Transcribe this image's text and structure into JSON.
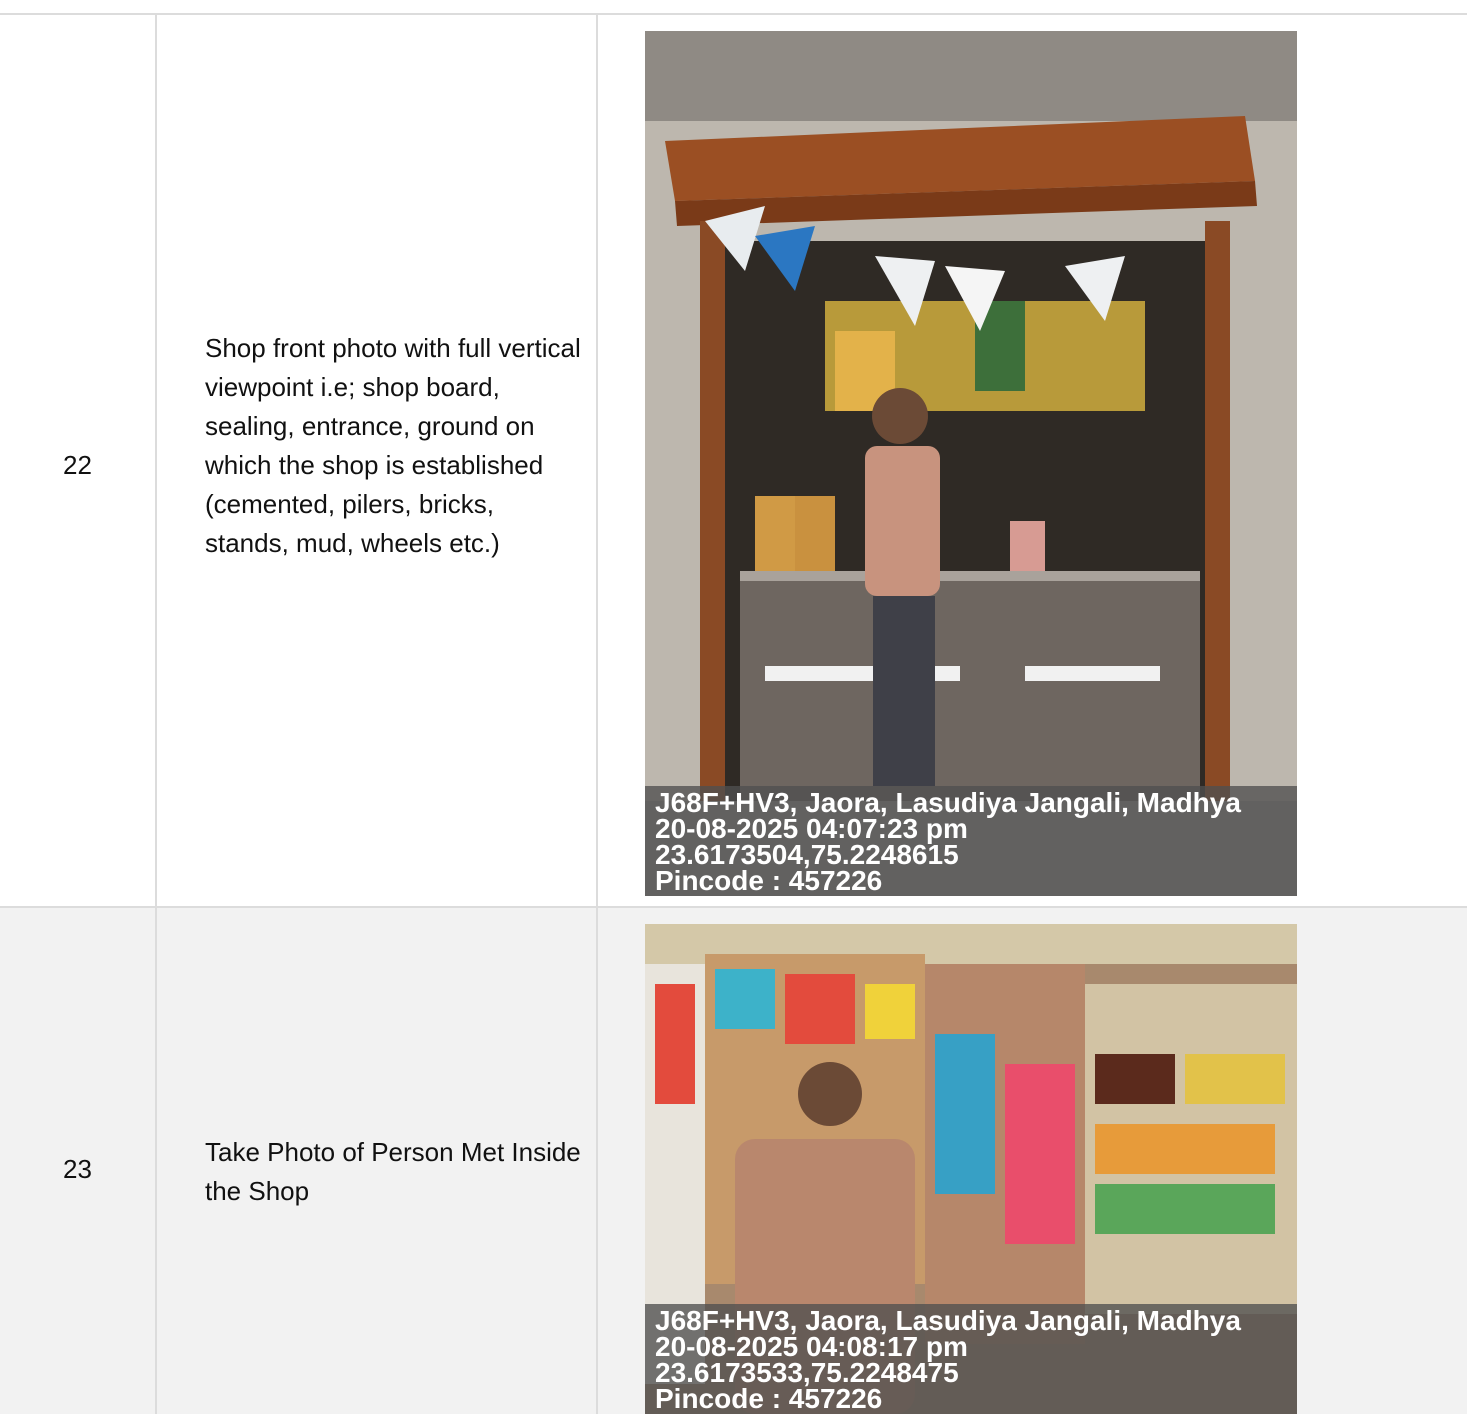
{
  "rows": [
    {
      "number": "22",
      "description": "Shop front photo with full vertical viewpoint i.e; shop board, sealing, entrance, ground on which the shop is established (cemented, pilers, bricks, stands, mud, wheels etc.)",
      "photo": {
        "stamp_line1": "J68F+HV3, Jaora, Lasudiya Jangali, Madhya",
        "stamp_line2": "20-08-2025 04:07:23 pm",
        "stamp_line3": "23.6173504,75.2248615",
        "stamp_line4": "Pincode : 457226"
      }
    },
    {
      "number": "23",
      "description": "Take Photo of Person Met Inside the Shop",
      "photo": {
        "stamp_line1": "J68F+HV3, Jaora, Lasudiya Jangali, Madhya",
        "stamp_line2": "20-08-2025 04:08:17 pm",
        "stamp_line3": "23.6173533,75.2248475",
        "stamp_line4": "Pincode : 457226"
      }
    }
  ]
}
